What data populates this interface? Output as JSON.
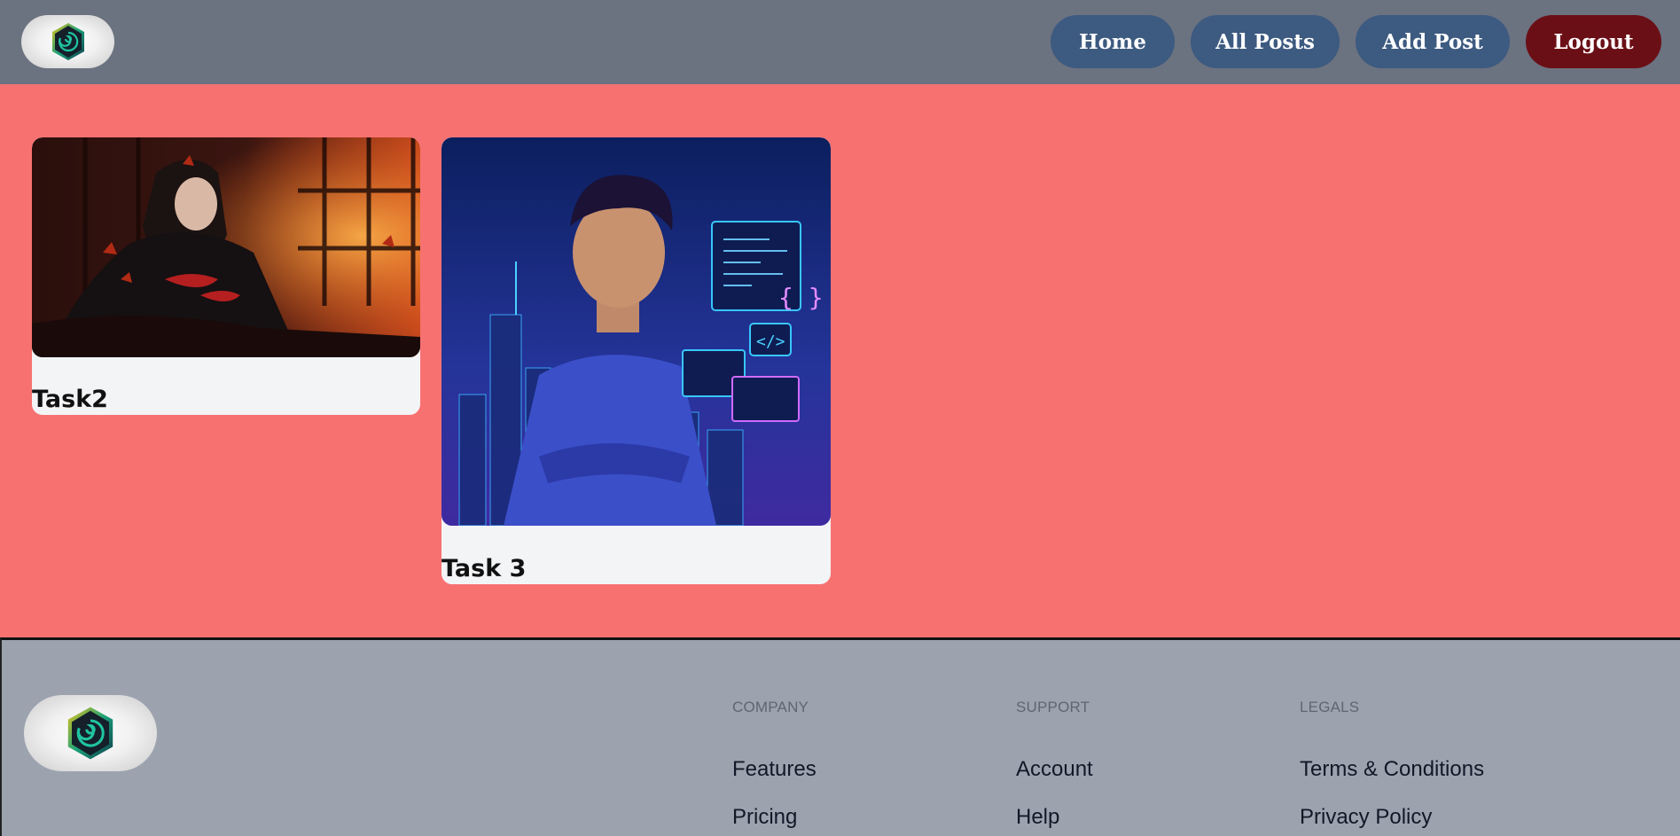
{
  "header": {
    "logo_icon": "app-logo-icon",
    "nav": [
      {
        "label": "Home",
        "color": "#3d5a80"
      },
      {
        "label": "All Posts",
        "color": "#3d5a80"
      },
      {
        "label": "Add Post",
        "color": "#3d5a80"
      },
      {
        "label": "Logout",
        "color": "#6b0f16"
      }
    ]
  },
  "main": {
    "background": "#f87171",
    "posts": [
      {
        "title": "Task2",
        "image": "anime-character-image"
      },
      {
        "title": "Task 3",
        "image": "developer-illustration-image"
      }
    ]
  },
  "footer": {
    "logo_icon": "app-logo-icon",
    "columns": [
      {
        "heading": "Company",
        "links": [
          "Features",
          "Pricing"
        ]
      },
      {
        "heading": "Support",
        "links": [
          "Account",
          "Help"
        ]
      },
      {
        "heading": "Legals",
        "links": [
          "Terms & Conditions",
          "Privacy Policy"
        ]
      }
    ]
  }
}
